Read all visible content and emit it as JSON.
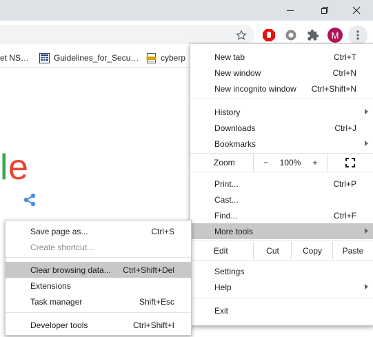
{
  "bookmarks": [
    {
      "label": "et NS…",
      "icon": "page-icon"
    },
    {
      "label": "Guidelines_for_Secu…",
      "icon": "document-grid-icon"
    },
    {
      "label": "cyberp",
      "icon": "pdf-icon"
    }
  ],
  "profile": {
    "initial": "M"
  },
  "logo": {
    "letters": [
      "l",
      "e"
    ],
    "colors": [
      "#34a853",
      "#ea4335"
    ]
  },
  "chrome_menu": {
    "group1": [
      {
        "label": "New tab",
        "shortcut": "Ctrl+T"
      },
      {
        "label": "New window",
        "shortcut": "Ctrl+N"
      },
      {
        "label": "New incognito window",
        "shortcut": "Ctrl+Shift+N"
      }
    ],
    "group2": [
      {
        "label": "History"
      },
      {
        "label": "Downloads",
        "shortcut": "Ctrl+J"
      },
      {
        "label": "Bookmarks"
      }
    ],
    "zoom": {
      "label": "Zoom",
      "minus": "−",
      "value": "100%",
      "plus": "+"
    },
    "group3": [
      {
        "label": "Print...",
        "shortcut": "Ctrl+P"
      },
      {
        "label": "Cast..."
      },
      {
        "label": "Find...",
        "shortcut": "Ctrl+F"
      },
      {
        "label": "More tools"
      }
    ],
    "edit": {
      "label": "Edit",
      "cut": "Cut",
      "copy": "Copy",
      "paste": "Paste"
    },
    "group4": [
      {
        "label": "Settings"
      },
      {
        "label": "Help"
      }
    ],
    "exit": {
      "label": "Exit"
    }
  },
  "more_tools_menu": {
    "items": [
      {
        "label": "Save page as...",
        "shortcut": "Ctrl+S"
      },
      {
        "label": "Create shortcut..."
      },
      {
        "label": "Clear browsing data...",
        "shortcut": "Ctrl+Shift+Del"
      },
      {
        "label": "Extensions"
      },
      {
        "label": "Task manager",
        "shortcut": "Shift+Esc"
      },
      {
        "label": "Developer tools",
        "shortcut": "Ctrl+Shift+I"
      }
    ]
  },
  "colors": {
    "titlebar": "#dee1e6",
    "highlight": "#c8c8c8",
    "share_icon": "#4a90e2"
  }
}
